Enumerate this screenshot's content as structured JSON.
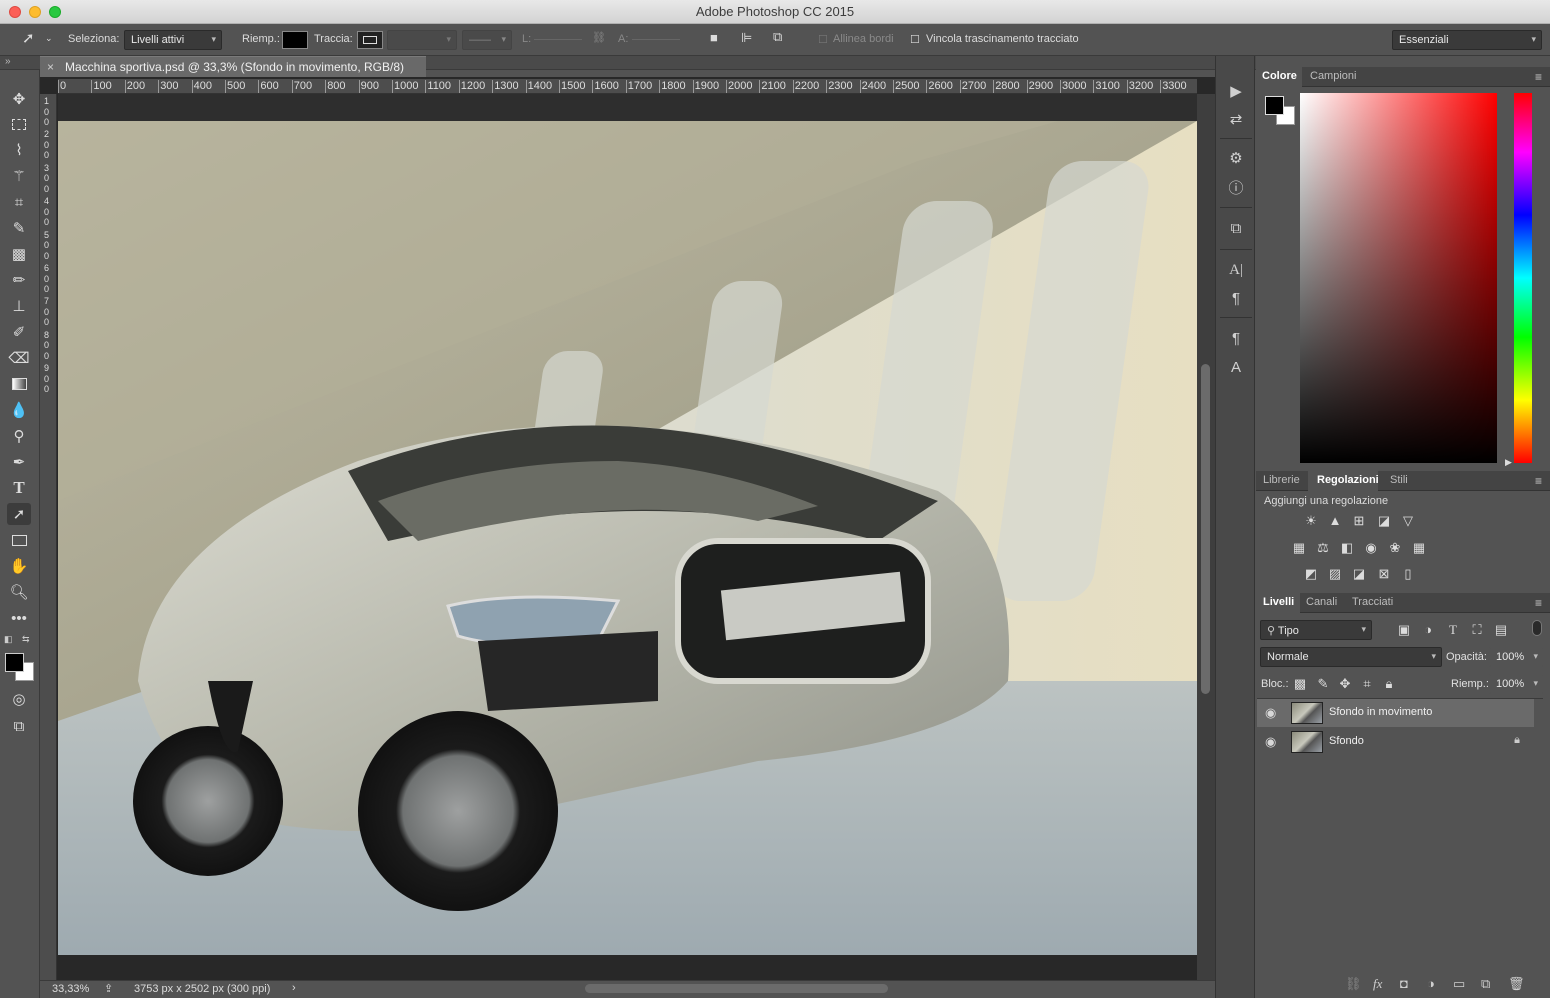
{
  "window": {
    "title": "Adobe Photoshop CC 2015"
  },
  "options": {
    "select_label": "Seleziona:",
    "select_value": "Livelli attivi",
    "fill_label": "Riemp.:",
    "stroke_label": "Traccia:",
    "w_label": "L:",
    "h_label": "A:",
    "align_edges": "Allinea bordi",
    "constrain_path": "Vincola trascinamento tracciato",
    "workspace": "Essenziali"
  },
  "document": {
    "tab_title": "Macchina sportiva.psd @ 33,3% (Sfondo in movimento, RGB/8)",
    "ruler_labels": [
      "0",
      "100",
      "200",
      "300",
      "400",
      "500",
      "600",
      "700",
      "800",
      "900",
      "1000",
      "1100",
      "1200",
      "1300",
      "1400",
      "1500",
      "1600",
      "1700",
      "1800",
      "1900",
      "2000",
      "2100",
      "2200",
      "2300",
      "2400",
      "2500",
      "2600",
      "2700",
      "2800",
      "2900",
      "3000",
      "3100",
      "3200",
      "3300"
    ],
    "vruler_labels": [
      "1",
      "0",
      "0",
      "2",
      "0",
      "0",
      "3",
      "0",
      "0",
      "4",
      "0",
      "0",
      "5",
      "0",
      "0",
      "6",
      "0",
      "0",
      "7",
      "0",
      "0",
      "8",
      "0",
      "0",
      "9",
      "0",
      "0"
    ]
  },
  "status": {
    "zoom": "33,33%",
    "doc_info": "3753 px x 2502 px (300 ppi)",
    "arrow": "›"
  },
  "color_panel": {
    "tabs": [
      "Colore",
      "Campioni"
    ],
    "foreground": "#000000",
    "background": "#ffffff"
  },
  "adjust_panel": {
    "tabs": [
      "Librerie",
      "Regolazioni",
      "Stili"
    ],
    "heading": "Aggiungi una regolazione"
  },
  "layers_panel": {
    "tabs": [
      "Livelli",
      "Canali",
      "Tracciati"
    ],
    "filter": "Tipo",
    "blend_mode": "Normale",
    "opacity_label": "Opacità:",
    "opacity_value": "100%",
    "lock_label": "Bloc.:",
    "fill_label": "Riemp.:",
    "fill_value": "100%",
    "layers": [
      {
        "name": "Sfondo in movimento",
        "selected": true,
        "locked": false
      },
      {
        "name": "Sfondo",
        "selected": false,
        "locked": true
      }
    ]
  },
  "icons": {
    "close": "×",
    "eye": "◉",
    "lock": "🔒",
    "menu": "≡"
  }
}
